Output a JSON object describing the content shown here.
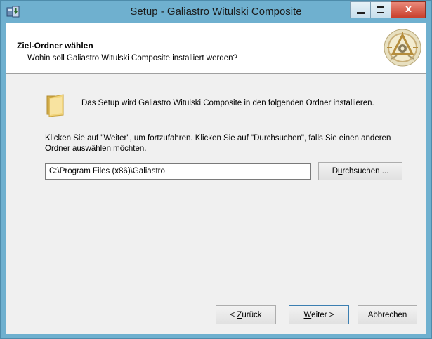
{
  "window": {
    "title": "Setup - Galiastro Witulski Composite",
    "close_glyph": "x"
  },
  "header": {
    "title": "Ziel-Ordner wählen",
    "subtitle": "Wohin soll Galiastro Witulski Composite installiert werden?"
  },
  "body": {
    "info_text": "Das Setup wird Galiastro Witulski Composite in den folgenden Ordner installieren.",
    "instruction_text": "Klicken Sie auf \"Weiter\", um fortzufahren. Klicken Sie auf \"Durchsuchen\", falls Sie einen anderen Ordner auswählen möchten.",
    "path_value": "C:\\Program Files (x86)\\Galiastro",
    "browse": {
      "pre": "D",
      "accel": "u",
      "post": "rchsuchen ..."
    }
  },
  "footer": {
    "back": {
      "pre": "< ",
      "accel": "Z",
      "post": "urück"
    },
    "next": {
      "pre": "",
      "accel": "W",
      "post": "eiter >"
    },
    "cancel_label": "Abbrechen"
  },
  "icons": {
    "app": "setup-app-icon",
    "folder": "folder-icon",
    "logo": "galiastro-logo"
  }
}
